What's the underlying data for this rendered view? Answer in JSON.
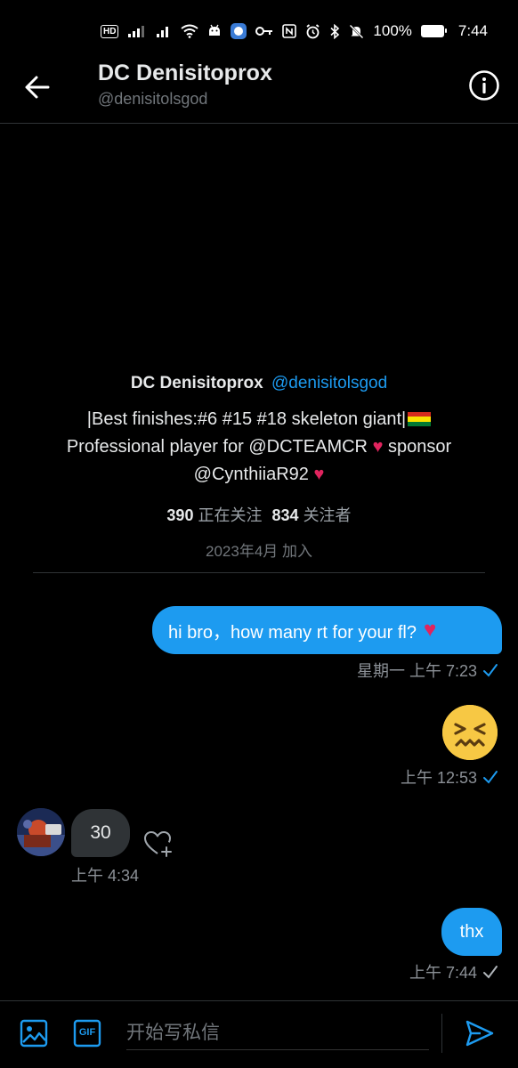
{
  "status_bar": {
    "hd": "HD",
    "battery_percent": "100%",
    "time": "7:44"
  },
  "header": {
    "title": "DC Denisitoprox",
    "handle": "@denisitolsgod"
  },
  "profile_card": {
    "name": "DC Denisitoprox",
    "handle": "@denisitolsgod",
    "bio_line1": "|Best finishes:#6 #15 #18 skeleton giant|",
    "bio_line2": "Professional player for @DCTEAMCR",
    "bio_line2_after": " sponsor",
    "bio_line3": "@CynthiiaR92",
    "heart": "♥",
    "following_count": "390",
    "following_label": "正在关注",
    "followers_count": "834",
    "followers_label": "关注者",
    "joined": "2023年4月 加入"
  },
  "messages": [
    {
      "direction": "sent",
      "text": "hi bro，how many rt for your fl?",
      "emoji": "♥",
      "time": "星期一 上午 7:23"
    },
    {
      "direction": "sent",
      "type": "emoji",
      "emoji": "confounded-face",
      "time": "上午 12:53"
    },
    {
      "direction": "received",
      "text": "30",
      "time": "上午 4:34"
    },
    {
      "direction": "sent",
      "text": "thx",
      "time": "上午 7:44"
    }
  ],
  "composer": {
    "placeholder": "开始写私信",
    "gif_label": "GIF"
  },
  "colors": {
    "accent": "#1d9bf0",
    "heart": "#e0245e",
    "background": "#000000",
    "received_bubble": "#2f3336"
  }
}
